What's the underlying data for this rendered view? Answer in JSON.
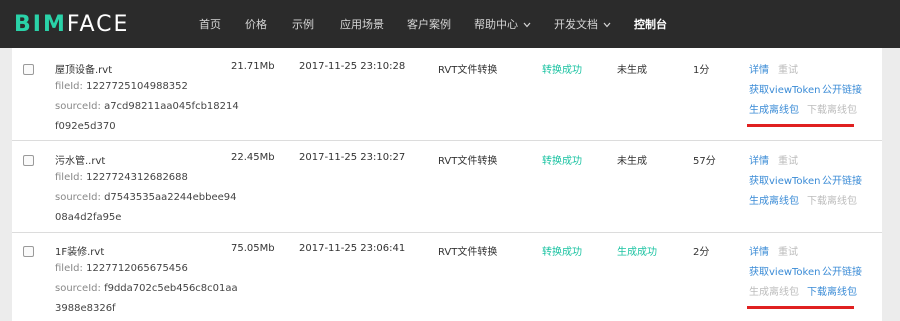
{
  "header": {
    "logo_bim": "BIM",
    "logo_face": "FACE",
    "nav": [
      {
        "label": "首页",
        "active": false,
        "dropdown": false
      },
      {
        "label": "价格",
        "active": false,
        "dropdown": false
      },
      {
        "label": "示例",
        "active": false,
        "dropdown": false
      },
      {
        "label": "应用场景",
        "active": false,
        "dropdown": false
      },
      {
        "label": "客户案例",
        "active": false,
        "dropdown": false
      },
      {
        "label": "帮助中心",
        "active": false,
        "dropdown": true
      },
      {
        "label": "开发文档",
        "active": false,
        "dropdown": true
      },
      {
        "label": "控制台",
        "active": true,
        "dropdown": false
      }
    ],
    "chevron_icon": "chevron-down-icon"
  },
  "rows": [
    {
      "filename": "屋顶设备.rvt",
      "fileid_label": "fileId:",
      "fileid": "1227725104988352",
      "sourceid_label": "sourceId:",
      "sourceid_1": "a7cd98211aa045fcb18214",
      "sourceid_2": "f092e5d370",
      "size": "21.71Mb",
      "time": "2017-11-25 23:10:28",
      "type": "RVT文件转换",
      "status": "转换成功",
      "offline": "未生成",
      "duration": "1分",
      "actions": {
        "detail": "详情",
        "retry": "重试",
        "get_token": "获取viewToken",
        "public_link": "公开链接",
        "gen_offline": "生成离线包",
        "download_offline": "下载离线包"
      }
    },
    {
      "filename": "污水管..rvt",
      "fileid_label": "fileId:",
      "fileid": "1227724312682688",
      "sourceid_label": "sourceId:",
      "sourceid_1": "d7543535aa2244ebbee94",
      "sourceid_2": "08a4d2fa95e",
      "size": "22.45Mb",
      "time": "2017-11-25 23:10:27",
      "type": "RVT文件转换",
      "status": "转换成功",
      "offline": "未生成",
      "duration": "57分",
      "actions": {
        "detail": "详情",
        "retry": "重试",
        "get_token": "获取viewToken",
        "public_link": "公开链接",
        "gen_offline": "生成离线包",
        "download_offline": "下载离线包"
      }
    },
    {
      "filename": "1F装修.rvt",
      "fileid_label": "fileId:",
      "fileid": "1227712065675456",
      "sourceid_label": "sourceId:",
      "sourceid_1": "f9dda702c5eb456c8c01aa",
      "sourceid_2": "3988e8326f",
      "size": "75.05Mb",
      "time": "2017-11-25 23:06:41",
      "type": "RVT文件转换",
      "status": "转换成功",
      "offline": "生成成功",
      "duration": "2分",
      "actions": {
        "detail": "详情",
        "retry": "重试",
        "get_token": "获取viewToken",
        "public_link": "公开链接",
        "gen_offline": "生成离线包",
        "download_offline": "下载离线包"
      }
    }
  ],
  "colors": {
    "success": "#1bc3a2",
    "link": "#3a8bd6",
    "disabled": "#bcbcbc",
    "annotation": "#e02020",
    "header_bg": "#2b2b2b",
    "brand": "#2ad2a8"
  }
}
